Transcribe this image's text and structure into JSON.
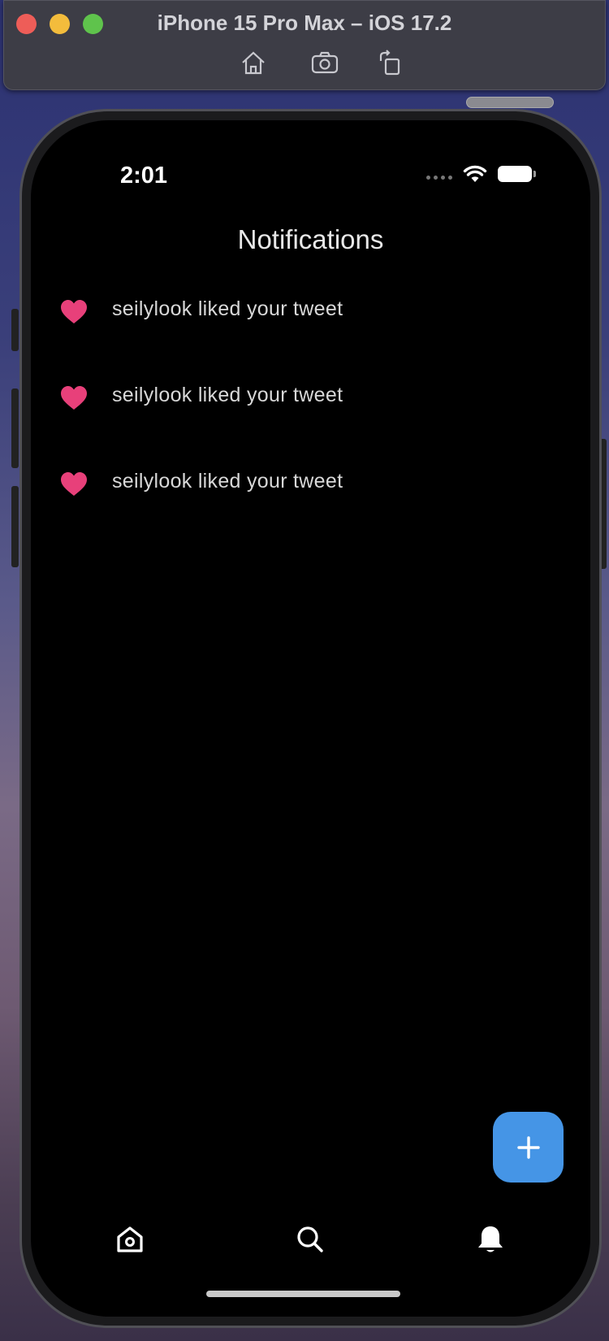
{
  "simulator": {
    "title": "iPhone 15 Pro Max – iOS 17.2",
    "toolbar": [
      "home-icon",
      "screenshot-icon",
      "rotate-icon"
    ]
  },
  "status_bar": {
    "time": "2:01"
  },
  "header": {
    "title": "Notifications"
  },
  "notifications": [
    {
      "icon": "heart-icon",
      "text": "seilylook liked your tweet"
    },
    {
      "icon": "heart-icon",
      "text": "seilylook liked your tweet"
    },
    {
      "icon": "heart-icon",
      "text": "seilylook liked your tweet"
    }
  ],
  "fab": {
    "icon": "plus-icon"
  },
  "tab_bar": [
    "home-icon",
    "search-icon",
    "bell-icon"
  ],
  "colors": {
    "heart": "#e8407a",
    "fab": "#4595e6",
    "background": "#000000"
  }
}
